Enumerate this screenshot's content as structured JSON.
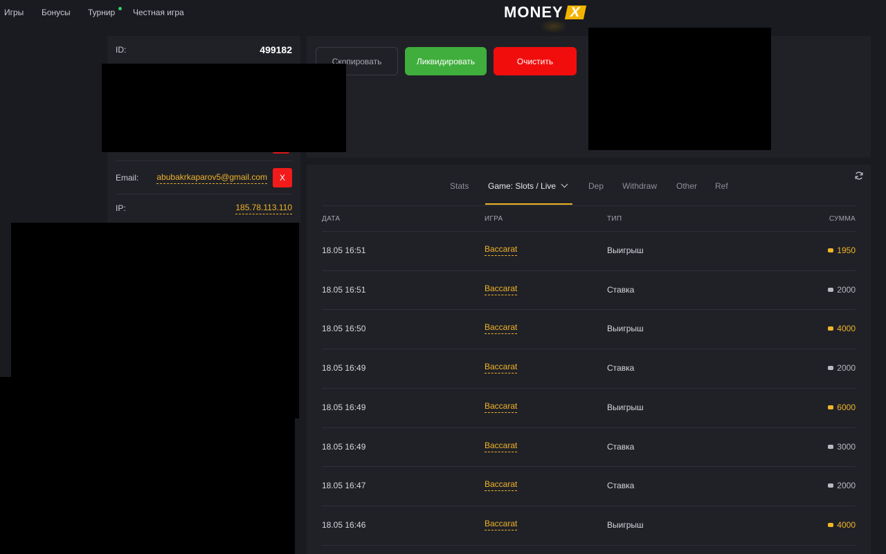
{
  "nav": {
    "items": [
      "Игры",
      "Бонусы",
      "Турнир",
      "Честная игра"
    ],
    "logo_text": "MONEY",
    "logo_badge": "X"
  },
  "profile": {
    "id_label": "ID:",
    "id_value": "499182",
    "email_label": "Email:",
    "email_value": "abubakrkaparov5@gmail.com",
    "email_remove": "X",
    "ip_label": "IP:",
    "ip_value": "185.78.113.110"
  },
  "actions": {
    "copy": "Скопировать",
    "liquidate": "Ликвидировать",
    "clear": "Очистить"
  },
  "tabs": {
    "stats": "Stats",
    "game": "Game: Slots / Live",
    "dep": "Dep",
    "withdraw": "Withdraw",
    "other": "Other",
    "ref": "Ref",
    "active": "game"
  },
  "table": {
    "headers": {
      "date": "ДАТА",
      "game": "ИГРА",
      "type": "ТИП",
      "amount": "СУММА"
    },
    "rows": [
      {
        "date": "18.05 16:51",
        "game": "Baccarat",
        "type": "Выигрыш",
        "amount": "1950",
        "win": true
      },
      {
        "date": "18.05 16:51",
        "game": "Baccarat",
        "type": "Ставка",
        "amount": "2000",
        "win": false
      },
      {
        "date": "18.05 16:50",
        "game": "Baccarat",
        "type": "Выигрыш",
        "amount": "4000",
        "win": true
      },
      {
        "date": "18.05 16:49",
        "game": "Baccarat",
        "type": "Ставка",
        "amount": "2000",
        "win": false
      },
      {
        "date": "18.05 16:49",
        "game": "Baccarat",
        "type": "Выигрыш",
        "amount": "6000",
        "win": true
      },
      {
        "date": "18.05 16:49",
        "game": "Baccarat",
        "type": "Ставка",
        "amount": "3000",
        "win": false
      },
      {
        "date": "18.05 16:47",
        "game": "Baccarat",
        "type": "Ставка",
        "amount": "2000",
        "win": false
      },
      {
        "date": "18.05 16:46",
        "game": "Baccarat",
        "type": "Выигрыш",
        "amount": "4000",
        "win": true
      }
    ]
  },
  "colors": {
    "accent": "#f0b429",
    "win_amount": "#f0b429",
    "bet_amount": "#b9bbc2",
    "danger": "#f20d0d",
    "success": "#3fae3c"
  }
}
